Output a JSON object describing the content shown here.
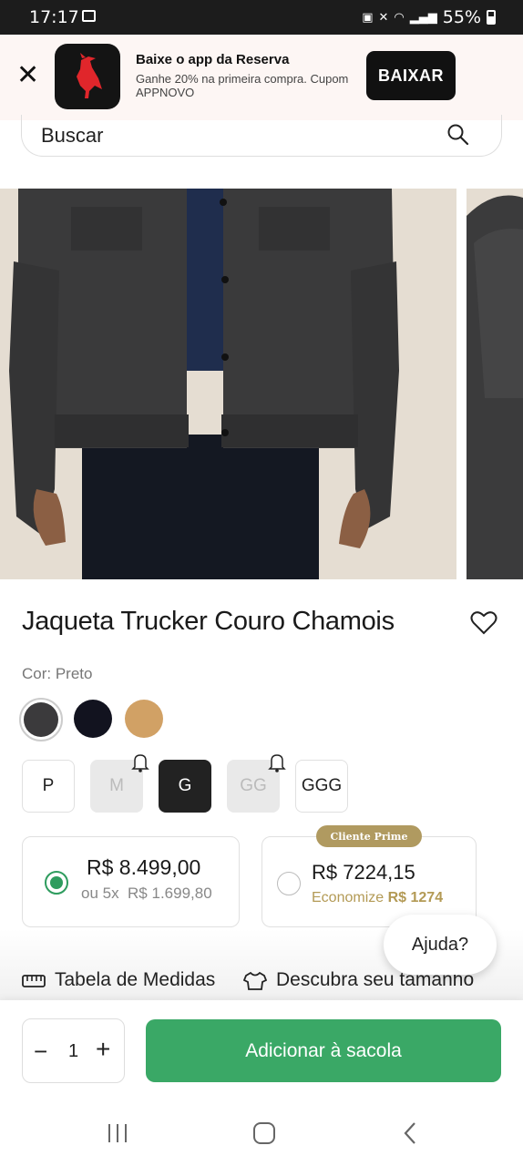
{
  "status": {
    "time": "17:17",
    "battery": "55%"
  },
  "app_banner": {
    "title": "Baixe o app da Reserva",
    "subtitle": "Ganhe 20% na primeira compra. Cupom APPNOVO",
    "button": "BAIXAR"
  },
  "search": {
    "placeholder": "Buscar"
  },
  "product": {
    "title": "Jaqueta Trucker Couro Chamois",
    "color_label": "Cor: Preto",
    "colors": [
      "#3b3a3c",
      "#12131f",
      "#d1a165"
    ],
    "sizes": [
      {
        "label": "P",
        "available": true,
        "selected": false
      },
      {
        "label": "M",
        "available": false,
        "selected": false
      },
      {
        "label": "G",
        "available": true,
        "selected": true
      },
      {
        "label": "GG",
        "available": false,
        "selected": false
      },
      {
        "label": "GGG",
        "available": true,
        "selected": false
      }
    ]
  },
  "pricing": {
    "regular": {
      "price": "R$ 8.499,00",
      "installments": "ou 5x  R$ 1.699,80",
      "selected": true
    },
    "prime": {
      "badge": "Cliente Prime",
      "price": "R$ 7224,15",
      "savings_prefix": "Economize",
      "savings_value": "R$ 1274",
      "selected": false
    }
  },
  "links": {
    "size_chart": "Tabela de Medidas",
    "find_size": "Descubra seu tamanho"
  },
  "help": {
    "label": "Ajuda?"
  },
  "cart": {
    "quantity": "1",
    "add_label": "Adicionar à sacola"
  },
  "colors": {
    "accent_green": "#3aa866",
    "prime_gold": "#b09a60"
  }
}
